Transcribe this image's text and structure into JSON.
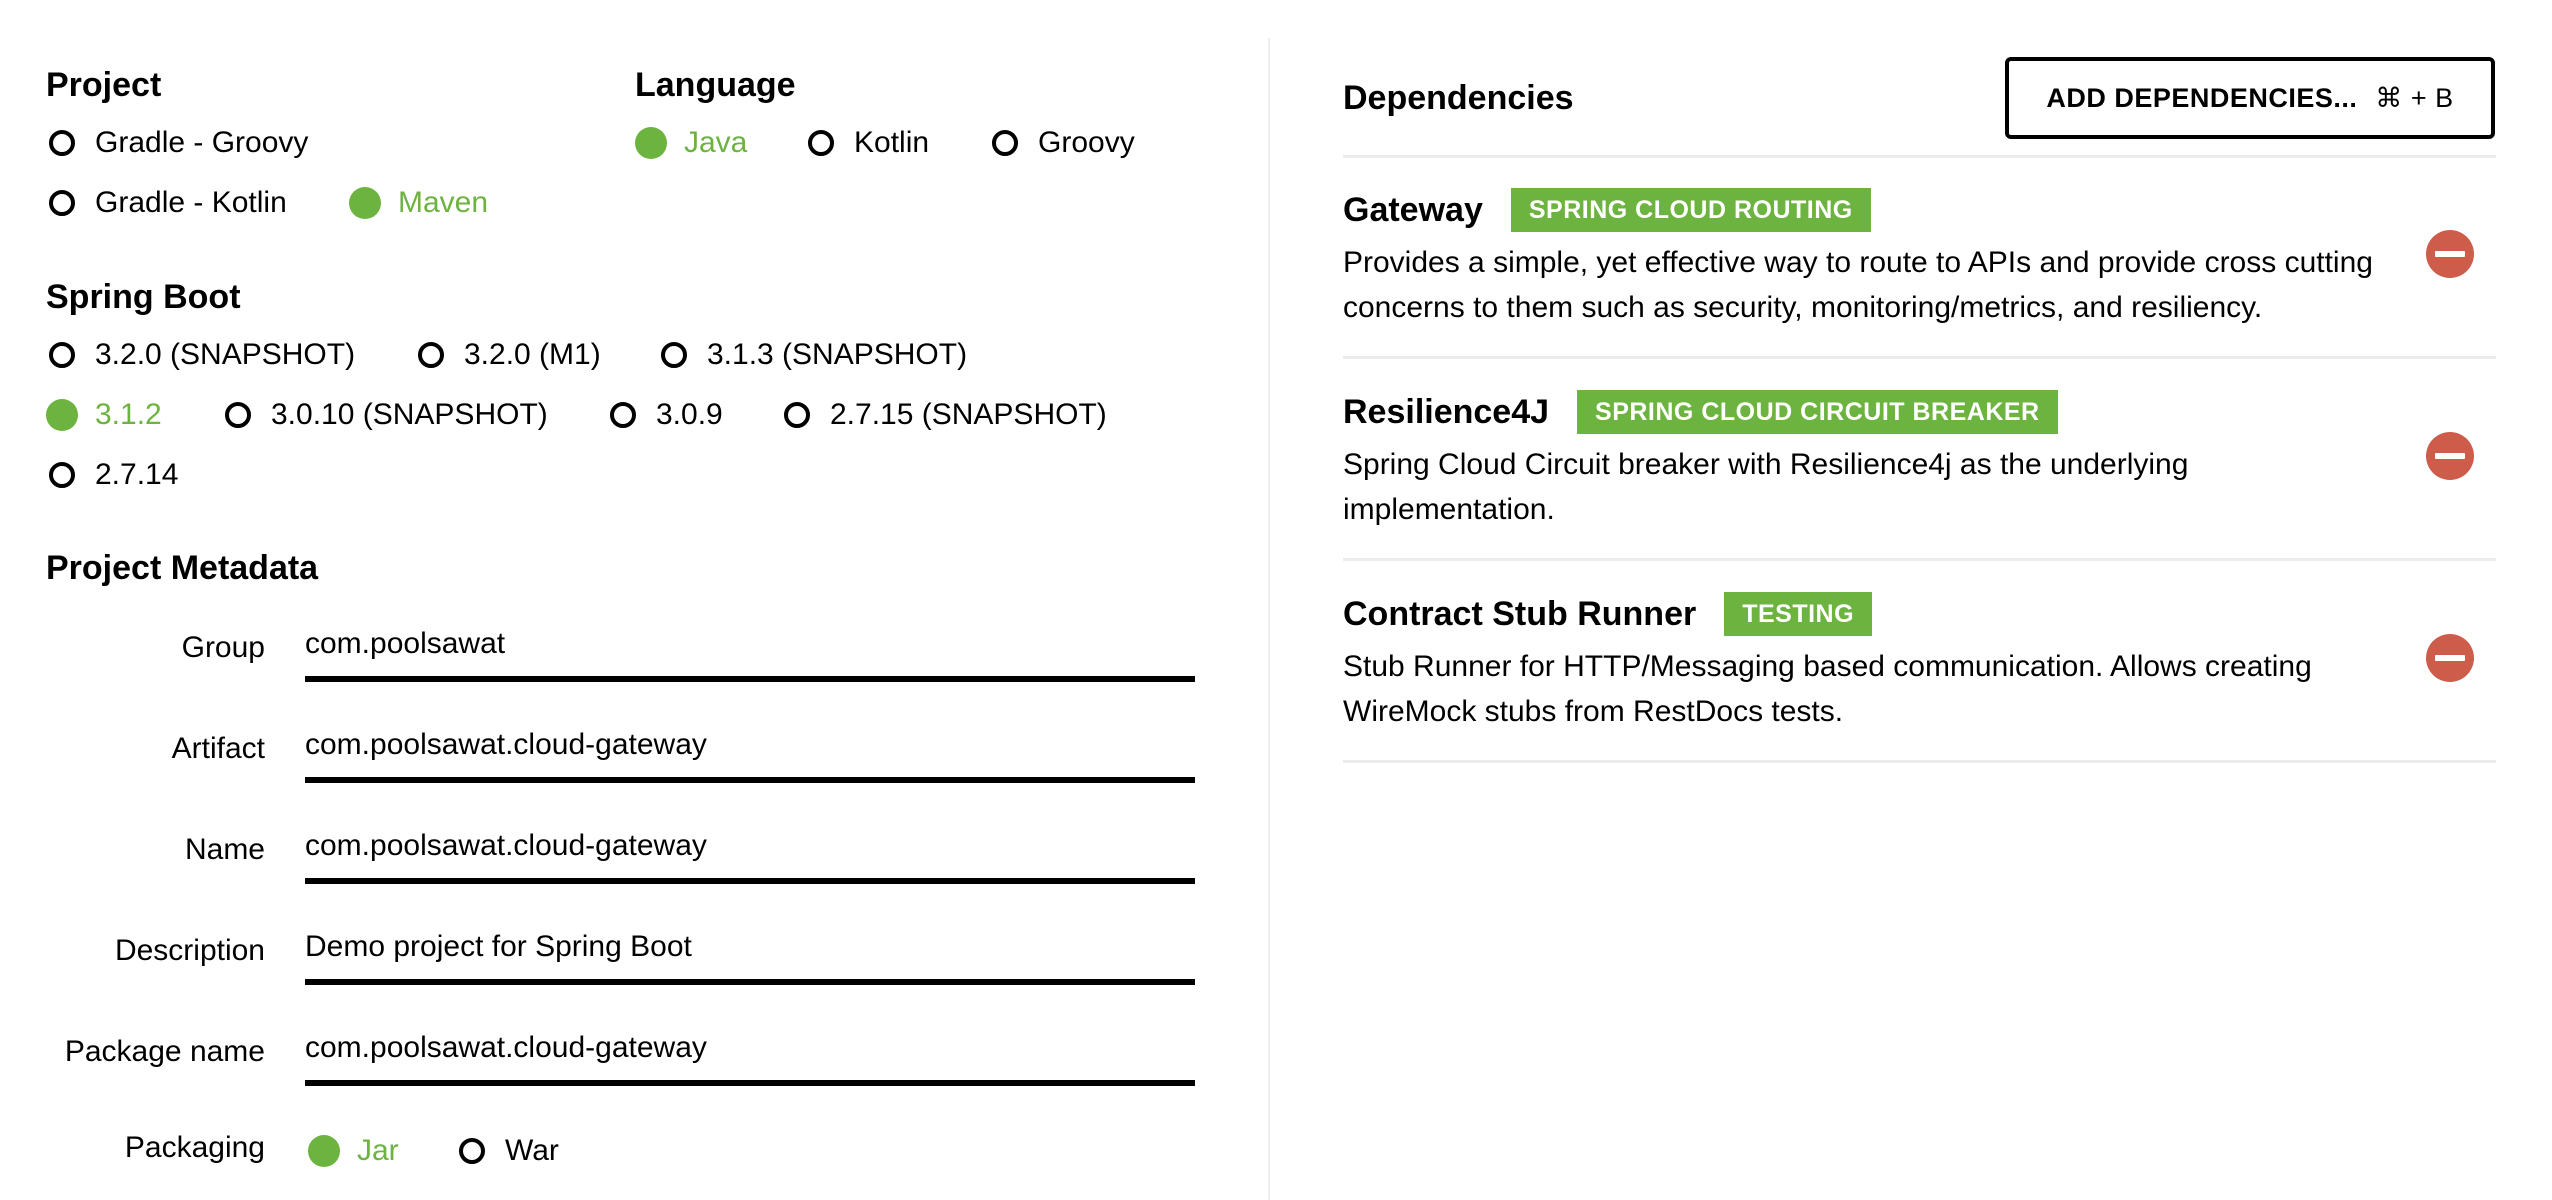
{
  "project": {
    "title": "Project",
    "options": [
      {
        "label": "Gradle - Groovy",
        "checked": false
      },
      {
        "label": "Gradle - Kotlin",
        "checked": false
      },
      {
        "label": "Maven",
        "checked": true
      }
    ]
  },
  "language": {
    "title": "Language",
    "options": [
      {
        "label": "Java",
        "checked": true
      },
      {
        "label": "Kotlin",
        "checked": false
      },
      {
        "label": "Groovy",
        "checked": false
      }
    ]
  },
  "spring_boot": {
    "title": "Spring Boot",
    "options": [
      {
        "label": "3.2.0 (SNAPSHOT)",
        "checked": false
      },
      {
        "label": "3.2.0 (M1)",
        "checked": false
      },
      {
        "label": "3.1.3 (SNAPSHOT)",
        "checked": false
      },
      {
        "label": "3.1.2",
        "checked": true
      },
      {
        "label": "3.0.10 (SNAPSHOT)",
        "checked": false
      },
      {
        "label": "3.0.9",
        "checked": false
      },
      {
        "label": "2.7.15 (SNAPSHOT)",
        "checked": false
      },
      {
        "label": "2.7.14",
        "checked": false
      }
    ]
  },
  "metadata": {
    "title": "Project Metadata",
    "fields": [
      {
        "label": "Group",
        "value": "com.poolsawat"
      },
      {
        "label": "Artifact",
        "value": "com.poolsawat.cloud-gateway"
      },
      {
        "label": "Name",
        "value": "com.poolsawat.cloud-gateway"
      },
      {
        "label": "Description",
        "value": "Demo project for Spring Boot"
      },
      {
        "label": "Package name",
        "value": "com.poolsawat.cloud-gateway"
      }
    ],
    "packaging": {
      "label": "Packaging",
      "options": [
        {
          "label": "Jar",
          "checked": true
        },
        {
          "label": "War",
          "checked": false
        }
      ]
    }
  },
  "dependencies": {
    "title": "Dependencies",
    "add_button": {
      "label": "ADD DEPENDENCIES...",
      "shortcut": "⌘ + B"
    },
    "items": [
      {
        "name": "Gateway",
        "badge": "SPRING CLOUD ROUTING",
        "description": "Provides a simple, yet effective way to route to APIs and provide cross cutting concerns to them such as security, monitoring/metrics, and resiliency."
      },
      {
        "name": "Resilience4J",
        "badge": "SPRING CLOUD CIRCUIT BREAKER",
        "description": "Spring Cloud Circuit breaker with Resilience4j as the underlying implementation."
      },
      {
        "name": "Contract Stub Runner",
        "badge": "TESTING",
        "description": "Stub Runner for HTTP/Messaging based communication. Allows creating WireMock stubs from RestDocs tests."
      }
    ]
  },
  "colors": {
    "accent": "#6db33f",
    "remove": "#cd5c4a",
    "divider": "#eeeeee"
  }
}
